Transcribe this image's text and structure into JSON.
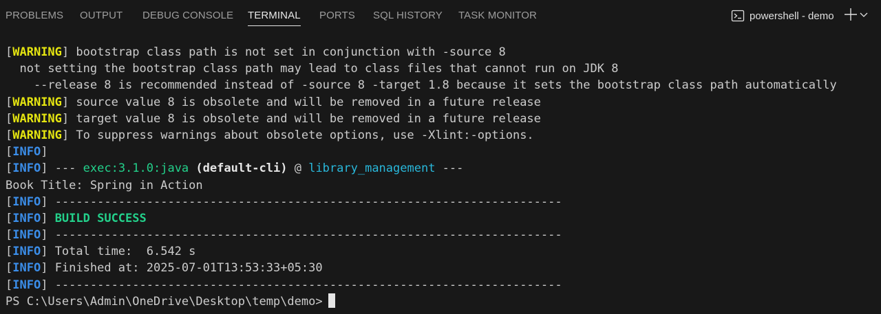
{
  "tabs": [
    {
      "label": "PROBLEMS"
    },
    {
      "label": "OUTPUT"
    },
    {
      "label": "DEBUG CONSOLE"
    },
    {
      "label": "TERMINAL"
    },
    {
      "label": "PORTS"
    },
    {
      "label": "SQL HISTORY"
    },
    {
      "label": "TASK MONITOR"
    }
  ],
  "active_tab": "TERMINAL",
  "terminal_title": "powershell - demo",
  "icons": {
    "terminal": "terminal-icon",
    "add": "plus-icon",
    "more": "chevron-down-icon"
  },
  "colors": {
    "background": "#181818",
    "warning": "#e5e510",
    "info": "#3b8eea",
    "success": "#23d18b",
    "link": "#29b8db"
  },
  "output": {
    "tag_warning": "WARNING",
    "tag_info": "INFO",
    "lines": [
      {
        "text": " bootstrap class path is not set in conjunction with -source 8"
      },
      {
        "text": "  not setting the bootstrap class path may lead to class files that cannot run on JDK 8"
      },
      {
        "text": "    --release 8 is recommended instead of -source 8 -target 1.8 because it sets the bootstrap class path automatically"
      },
      {
        "text": " source value 8 is obsolete and will be removed in a future release"
      },
      {
        "text": " target value 8 is obsolete and will be removed in a future release"
      },
      {
        "text": " To suppress warnings about obsolete options, use -Xlint:-options."
      },
      {
        "text": ""
      },
      {
        "dashes_open": " --- ",
        "goal": "exec:3.1.0:java",
        "execution": "(default-cli)",
        "at": " @ ",
        "artifact": "library_management",
        "dashes_close": " ---"
      },
      {
        "text": "Book Title: Spring in Action"
      },
      {
        "text": " ------------------------------------------------------------------------"
      },
      {
        "text": "BUILD SUCCESS"
      },
      {
        "text": " ------------------------------------------------------------------------"
      },
      {
        "text": " Total time:  6.542 s"
      },
      {
        "text": " Finished at: 2025-07-01T13:53:33+05:30"
      },
      {
        "text": " ------------------------------------------------------------------------"
      }
    ],
    "prompt": "PS C:\\Users\\Admin\\OneDrive\\Desktop\\temp\\demo>"
  }
}
